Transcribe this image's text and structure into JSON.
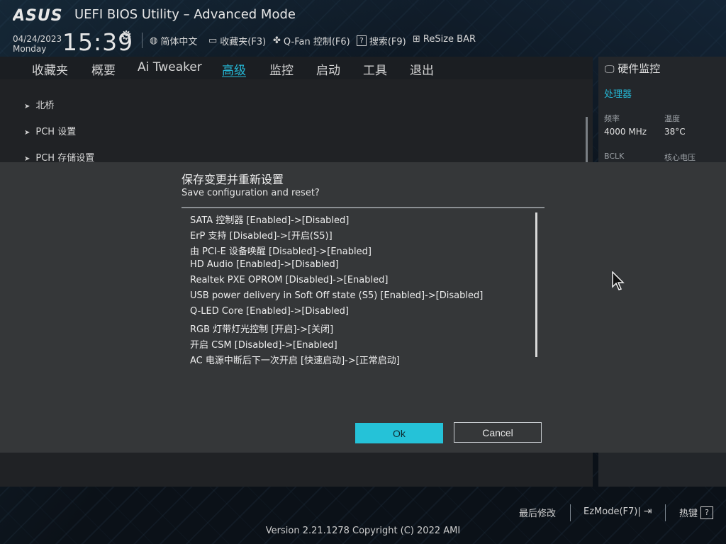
{
  "header": {
    "brand": "ASUS",
    "title": "UEFI BIOS Utility – Advanced Mode",
    "date": "04/24/2023",
    "weekday": "Monday",
    "time": "15:39",
    "tools": [
      {
        "label": "简体中文",
        "icon": "globe-icon"
      },
      {
        "label": "收藏夹(F3)",
        "icon": "bookmark-icon"
      },
      {
        "label": "Q-Fan 控制(F6)",
        "icon": "fan-icon"
      },
      {
        "label": "搜索(F9)",
        "icon": "help-search-icon"
      },
      {
        "label": "ReSize BAR",
        "icon": "resize-bar-icon"
      }
    ]
  },
  "nav": {
    "tabs": [
      "收藏夹",
      "概要",
      "Ai Tweaker",
      "高级",
      "监控",
      "启动",
      "工具",
      "退出"
    ],
    "active": "高级"
  },
  "menu": {
    "items": [
      "北桥",
      "PCH 设置",
      "PCH 存储设置"
    ]
  },
  "hardware_monitor": {
    "title": "硬件监控",
    "category": "处理器",
    "freq_label": "频率",
    "freq_value": "4000 MHz",
    "temp_label": "温度",
    "temp_value": "38°C",
    "bclk_label": "BCLK",
    "core_voltage_label": "核心电压"
  },
  "dialog": {
    "title_cn": "保存变更并重新设置",
    "title_en": "Save configuration and reset?",
    "changes": [
      "SATA 控制器 [Enabled]->[Disabled]",
      "ErP 支持 [Disabled]->[开启(S5)]",
      "由 PCI-E 设备唤醒 [Disabled]->[Enabled]",
      "HD Audio [Enabled]->[Disabled]",
      "Realtek PXE OPROM [Disabled]->[Enabled]",
      "USB power delivery in Soft Off state (S5) [Enabled]->[Disabled]",
      "Q-LED Core [Enabled]->[Disabled]",
      "RGB 灯带灯光控制 [开启]->[关闭]",
      "开启 CSM [Disabled]->[Enabled]",
      "AC 电源中断后下一次开启 [快速启动]->[正常启动]"
    ],
    "ok_label": "Ok",
    "cancel_label": "Cancel"
  },
  "footer": {
    "last_modified": "最后修改",
    "ezmode": "EzMode(F7)|",
    "hotkeys": "热键",
    "hotkey_symbol": "?",
    "version": "Version 2.21.1278 Copyright (C) 2022 AMI"
  },
  "colors": {
    "accent": "#25b8d6",
    "ok_button": "#25c2d8",
    "dialog_bg": "#353739"
  }
}
